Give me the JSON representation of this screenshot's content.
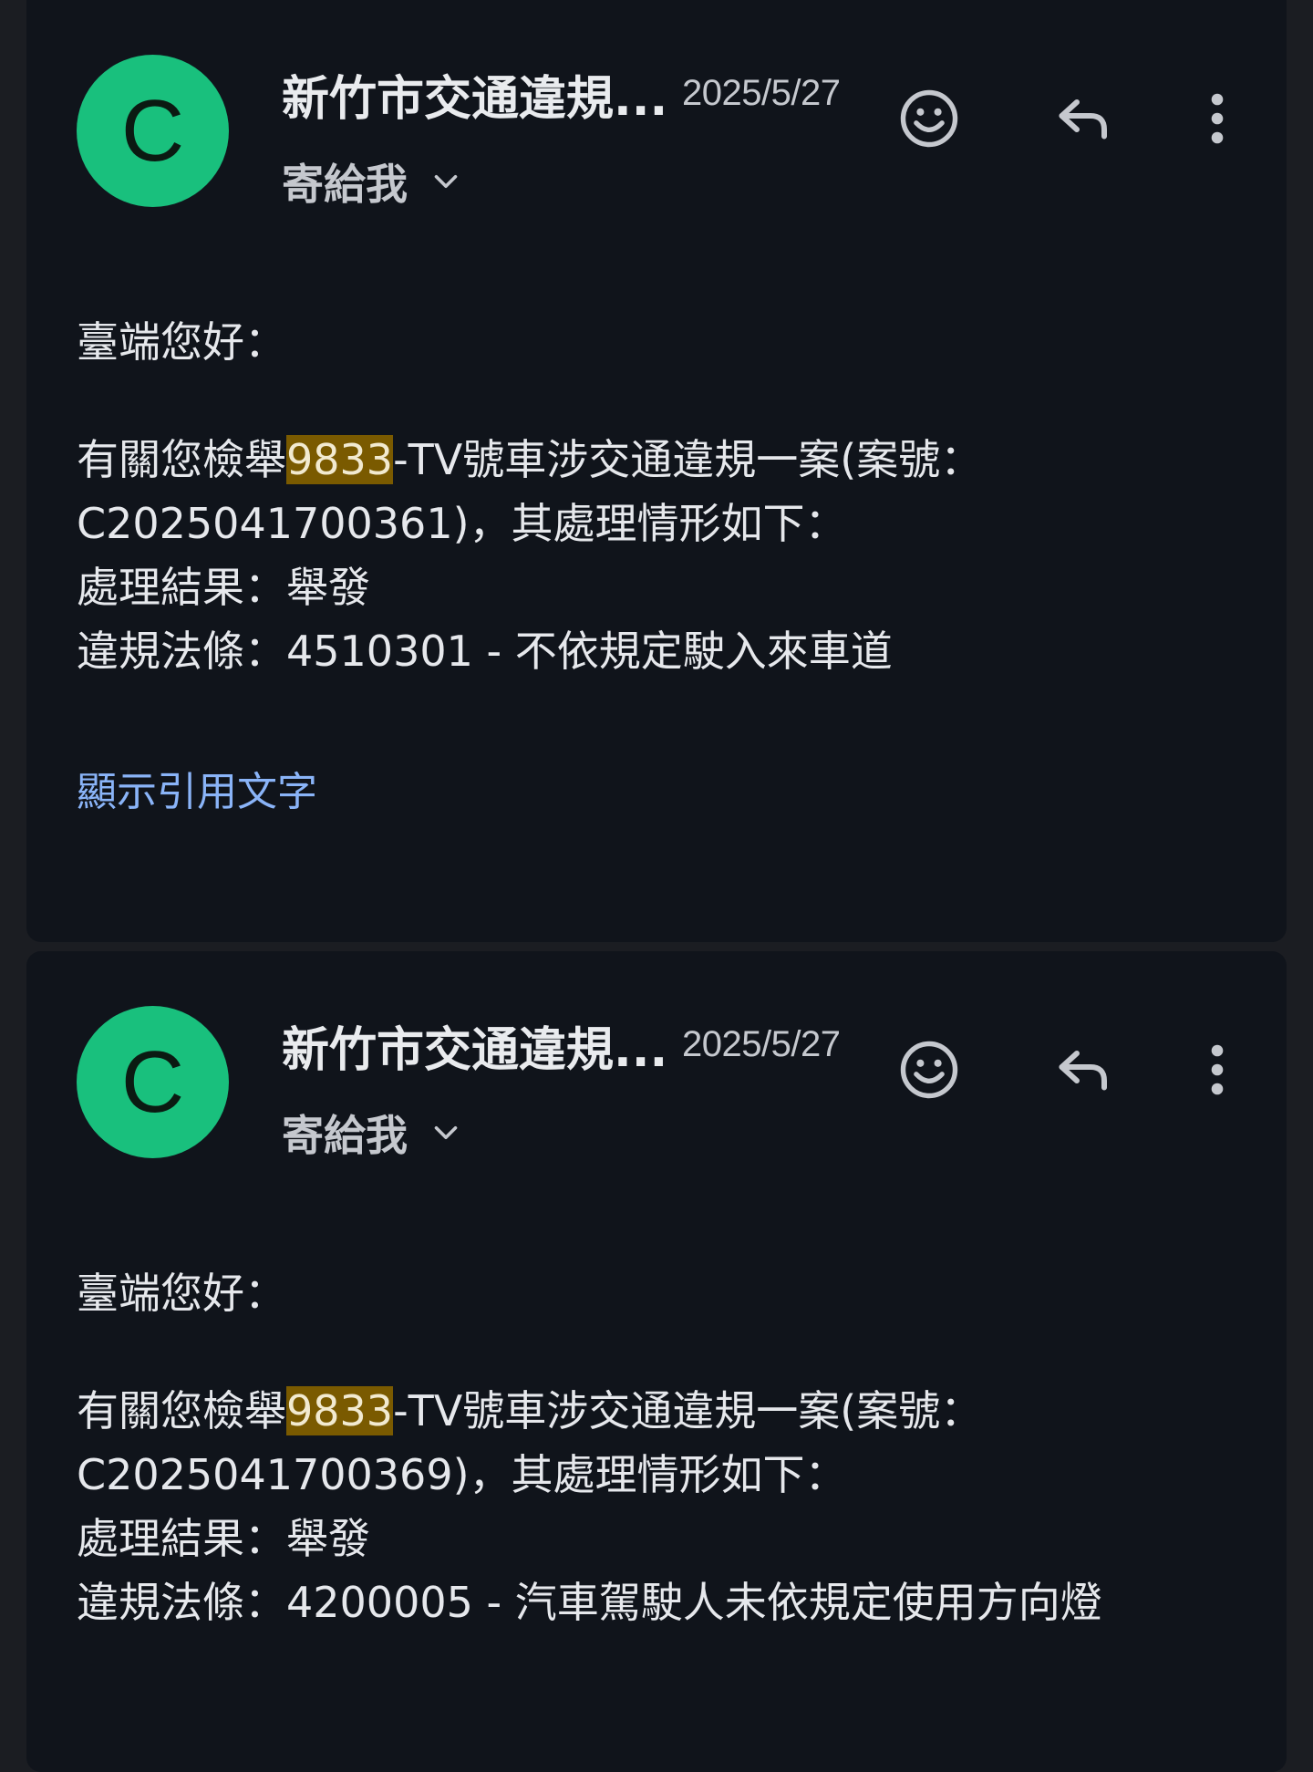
{
  "emails": [
    {
      "avatar_letter": "C",
      "sender": "新竹市交通違規...",
      "date": "2025/5/27",
      "recipient": "寄給我",
      "greeting": "臺端您好：",
      "line1_prefix": "有關您檢舉",
      "plate_highlight": "9833",
      "line1_suffix": "-TV號車涉交通違規一案(案號：",
      "line2": "C2025041700361)，其處理情形如下：",
      "line3": "處理結果：舉發",
      "line4": "違規法條：4510301 - 不依規定駛入來車道",
      "show_quoted": "顯示引用文字"
    },
    {
      "avatar_letter": "C",
      "sender": "新竹市交通違規...",
      "date": "2025/5/27",
      "recipient": "寄給我",
      "greeting": "臺端您好：",
      "line1_prefix": "有關您檢舉",
      "plate_highlight": "9833",
      "line1_suffix": "-TV號車涉交通違規一案(案號：",
      "line2": "C2025041700369)，其處理情形如下：",
      "line3": "處理結果：舉發",
      "line4": "違規法條：4200005 - 汽車駕駛人未依規定使用方向燈"
    }
  ],
  "icons": {
    "emoji": "smiley-face-icon",
    "reply": "reply-arrow-icon",
    "more": "more-vertical-icon",
    "expand": "chevron-down-icon"
  },
  "colors": {
    "card_bg": "#10141b",
    "avatar_bg": "#19c07d",
    "highlight_bg": "#7a5a00",
    "link": "#8ab4f8"
  }
}
